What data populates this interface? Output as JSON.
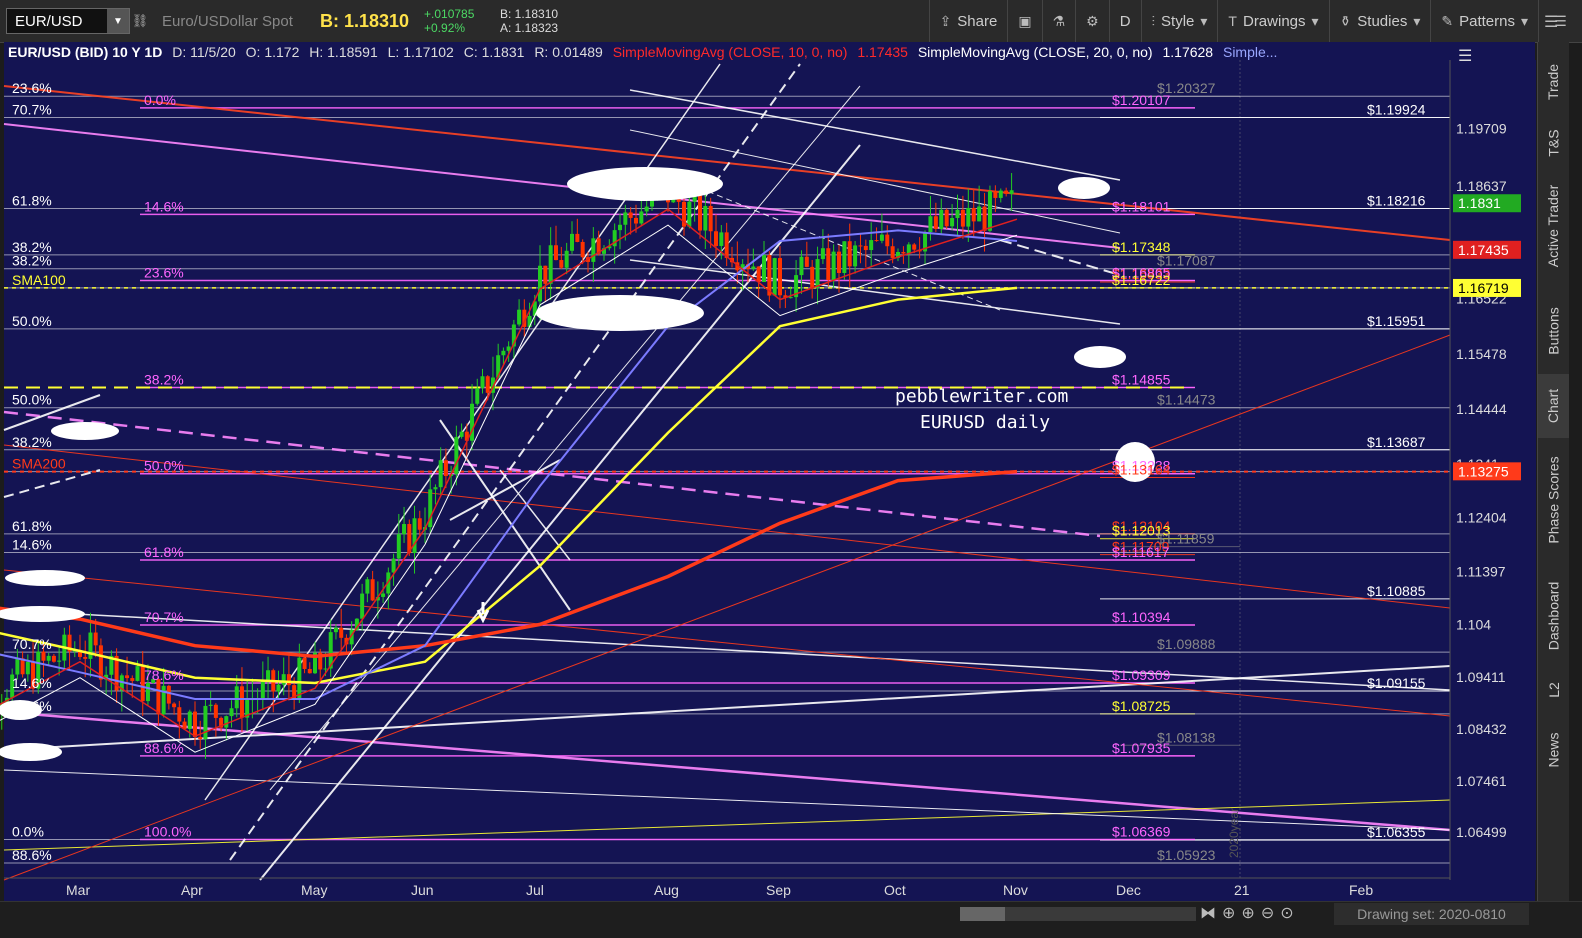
{
  "toolbar": {
    "symbol": "EUR/USD",
    "description": "Euro/USDollar Spot",
    "bid": "B: 1.18310",
    "change_abs": "+.010785",
    "change_pct": "+0.92%",
    "bid_small": "B: 1.18310",
    "ask_small": "A: 1.18323",
    "buttons": [
      {
        "label": "Share",
        "icon": "share-icon"
      },
      {
        "label": "",
        "icon": "snapshot-icon"
      },
      {
        "label": "",
        "icon": "flask-icon"
      },
      {
        "label": "",
        "icon": "gear-icon"
      },
      {
        "label": "D",
        "icon": ""
      },
      {
        "label": "Style",
        "icon": "style-icon"
      },
      {
        "label": "Drawings",
        "icon": "drawings-icon"
      },
      {
        "label": "Studies",
        "icon": "studies-icon"
      },
      {
        "label": "Patterns",
        "icon": "patterns-icon"
      }
    ]
  },
  "header": {
    "title": "EUR/USD (BID) 10 Y 1D",
    "date": "D: 11/5/20",
    "open": "O: 1.172",
    "high": "H: 1.18591",
    "low": "L: 1.17102",
    "close": "C: 1.1831",
    "range": "R: 0.01489",
    "sma10_label": "SimpleMovingAvg (CLOSE, 10, 0, no)",
    "sma10_value": "1.17435",
    "sma20_label": "SimpleMovingAvg (CLOSE, 20, 0, no)",
    "sma20_value": "1.17628",
    "more": "Simple..."
  },
  "sidebar": {
    "tabs": [
      "Trade",
      "T&S",
      "Active Trader",
      "Buttons",
      "Chart",
      "Phase Scores",
      "Dashboard",
      "L2",
      "News"
    ],
    "active": "Chart"
  },
  "bottom": {
    "drawing_set": "Drawing set: 2020-0810"
  },
  "colors": {
    "background": "#141453",
    "fib_magenta": "#ff66ff",
    "sma10": "#e02020",
    "sma20": "#ffffff",
    "sma50": "#7b7bff",
    "sma100": "#ffff33",
    "sma200": "#ff3a1a",
    "candle_up": "#22cc22",
    "candle_down": "#ff3300"
  },
  "chart_data": {
    "type": "candlestick",
    "title": "EUR/USD (BID) 10 Y 1D",
    "watermark": [
      "pebblewriter.com",
      "EURUSD daily"
    ],
    "x_labels": [
      "Mar",
      "Apr",
      "May",
      "Jun",
      "Jul",
      "Aug",
      "Sep",
      "Oct",
      "Nov",
      "Dec",
      "21",
      "Feb"
    ],
    "ylim": [
      1.056,
      1.21
    ],
    "y_ticks": [
      1.19709,
      1.18637,
      1.16522,
      1.15478,
      1.14444,
      1.1341,
      1.12404,
      1.11397,
      1.104,
      1.09411,
      1.08432,
      1.07461,
      1.06499
    ],
    "last_price": "1.1831",
    "price_badges": [
      {
        "value": "1.1831",
        "color": "#22aa22"
      },
      {
        "value": "1.17435",
        "color": "#e02020"
      },
      {
        "value": "1.16719",
        "color": "#ffff33"
      },
      {
        "value": "1.13275",
        "color": "#ff3a1a"
      }
    ],
    "series": [
      {
        "name": "SMA100",
        "label": "SMA100"
      },
      {
        "name": "SMA200",
        "label": "SMA200"
      }
    ],
    "monthly_path": [
      {
        "month": "Feb",
        "price": 1.088
      },
      {
        "month": "Mar",
        "price": 1.1
      },
      {
        "month": "Apr",
        "price": 1.086
      },
      {
        "month": "May",
        "price": 1.095
      },
      {
        "month": "Jun",
        "price": 1.125
      },
      {
        "month": "Jul",
        "price": 1.17
      },
      {
        "month": "Aug",
        "price": 1.185
      },
      {
        "month": "Sep",
        "price": 1.168
      },
      {
        "month": "Oct",
        "price": 1.176
      },
      {
        "month": "Nov",
        "price": 1.1831
      }
    ],
    "sma100_path": [
      1.104,
      1.099,
      1.094,
      1.093,
      1.097,
      1.115,
      1.14,
      1.16,
      1.165,
      1.1672
    ],
    "sma200_path": [
      1.108,
      1.105,
      1.1,
      1.098,
      1.1,
      1.104,
      1.113,
      1.123,
      1.131,
      1.1327
    ],
    "fib_labels_left": [
      {
        "text": "23.6%",
        "value": 1.2032
      },
      {
        "text": "70.7%",
        "value": 1.1992
      },
      {
        "text": "61.8%",
        "value": 1.1821
      },
      {
        "text": "38.2%",
        "value": 1.1734
      },
      {
        "text": "38.2%",
        "value": 1.1708
      },
      {
        "text": "SMA100",
        "value": 1.1672
      },
      {
        "text": "50.0%",
        "value": 1.1595
      },
      {
        "text": "50.0%",
        "value": 1.1447
      },
      {
        "text": "38.2%",
        "value": 1.1368
      },
      {
        "text": "SMA200",
        "value": 1.1327
      },
      {
        "text": "61.8%",
        "value": 1.121
      },
      {
        "text": "14.6%",
        "value": 1.1175
      },
      {
        "text": "70.7%",
        "value": 1.0988
      },
      {
        "text": "14.6%",
        "value": 1.0915
      },
      {
        "text": "14.6%",
        "value": 1.0872
      },
      {
        "text": "0.0%",
        "value": 1.0636
      },
      {
        "text": "88.6%",
        "value": 1.0592
      }
    ],
    "fib_labels_mid": [
      {
        "text": "0.0%",
        "value": 1.201
      },
      {
        "text": "14.6%",
        "value": 1.181
      },
      {
        "text": "23.6%",
        "value": 1.1686
      },
      {
        "text": "38.2%",
        "value": 1.1485
      },
      {
        "text": "50.0%",
        "value": 1.1323
      },
      {
        "text": "61.8%",
        "value": 1.1161
      },
      {
        "text": "70.7%",
        "value": 1.1039
      },
      {
        "text": "78.6%",
        "value": 1.093
      },
      {
        "text": "88.6%",
        "value": 1.0793
      },
      {
        "text": "100.0%",
        "value": 1.0636
      }
    ],
    "level_labels": [
      {
        "text": "$1.20327",
        "value": 1.2032,
        "color": "#888888"
      },
      {
        "text": "$1.20107",
        "value": 1.201,
        "color": "#ff66ff"
      },
      {
        "text": "$1.19924",
        "value": 1.1992,
        "color": "#ffffff"
      },
      {
        "text": "$1.18216",
        "value": 1.1821,
        "color": "#ffffff"
      },
      {
        "text": "$1.18101",
        "value": 1.181,
        "color": "#ff66ff"
      },
      {
        "text": "$1.17348",
        "value": 1.1734,
        "color": "#ffff33"
      },
      {
        "text": "$1.17087",
        "value": 1.1708,
        "color": "#888888"
      },
      {
        "text": "$1.16833",
        "value": 1.1683,
        "color": "#ff3a1a"
      },
      {
        "text": "$1.16865",
        "value": 1.1686,
        "color": "#ff66ff"
      },
      {
        "text": "$1.16722",
        "value": 1.1672,
        "color": "#ffff33"
      },
      {
        "text": "$1.15951",
        "value": 1.1595,
        "color": "#ffffff"
      },
      {
        "text": "$1.14855",
        "value": 1.1485,
        "color": "#ff66ff"
      },
      {
        "text": "$1.14473",
        "value": 1.1447,
        "color": "#888888"
      },
      {
        "text": "$1.13687",
        "value": 1.1368,
        "color": "#ffffff"
      },
      {
        "text": "$1.13238",
        "value": 1.1323,
        "color": "#ff66ff"
      },
      {
        "text": "$1.13164",
        "value": 1.1316,
        "color": "#ff3a1a"
      },
      {
        "text": "$1.12104",
        "value": 1.121,
        "color": "#ff3a1a"
      },
      {
        "text": "$1.12013",
        "value": 1.1201,
        "color": "#ffff33"
      },
      {
        "text": "$1.11859",
        "value": 1.1186,
        "color": "#888888"
      },
      {
        "text": "$1.11709",
        "value": 1.1171,
        "color": "#ff3a1a"
      },
      {
        "text": "$1.11617",
        "value": 1.1161,
        "color": "#ff66ff"
      },
      {
        "text": "$1.10885",
        "value": 1.1088,
        "color": "#ffffff"
      },
      {
        "text": "$1.10394",
        "value": 1.1039,
        "color": "#ff66ff"
      },
      {
        "text": "$1.09888",
        "value": 1.0988,
        "color": "#888888"
      },
      {
        "text": "$1.09309",
        "value": 1.093,
        "color": "#ff66ff"
      },
      {
        "text": "$1.09155",
        "value": 1.0915,
        "color": "#ffffff"
      },
      {
        "text": "$1.08725",
        "value": 1.0872,
        "color": "#ffff33"
      },
      {
        "text": "$1.08138",
        "value": 1.0813,
        "color": "#888888"
      },
      {
        "text": "$1.07935",
        "value": 1.0793,
        "color": "#ff66ff"
      },
      {
        "text": "$1.06369",
        "value": 1.0636,
        "color": "#ff66ff"
      },
      {
        "text": "$1.06355",
        "value": 1.0635,
        "color": "#ffffff"
      },
      {
        "text": "$1.05923",
        "value": 1.0592,
        "color": "#888888"
      }
    ],
    "vertical_label": "2020year"
  }
}
